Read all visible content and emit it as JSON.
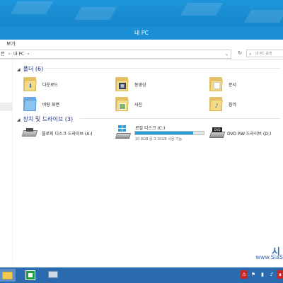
{
  "window": {
    "title": "내 PC"
  },
  "ribbon": {
    "tab_view": "보기"
  },
  "address": {
    "root_fragment": "픈",
    "sep1": "›",
    "location": "내 PC",
    "sep2": "›",
    "dropdown": "⌄",
    "refresh": "↻",
    "search_placeholder": "내 PC 검색"
  },
  "folders_section": {
    "title": "폴더 (6)",
    "chevron": "◢"
  },
  "folders": [
    {
      "label": "다운로드",
      "icon": "downloads-folder-icon"
    },
    {
      "label": "동영상",
      "icon": "videos-folder-icon"
    },
    {
      "label": "문서",
      "icon": "documents-folder-icon"
    },
    {
      "label": "바탕 화면",
      "icon": "desktop-folder-icon"
    },
    {
      "label": "사진",
      "icon": "pictures-folder-icon"
    },
    {
      "label": "음악",
      "icon": "music-folder-icon"
    }
  ],
  "devices_section": {
    "title": "장치 및 드라이브 (3)",
    "chevron": "◢"
  },
  "devices": [
    {
      "label": "플로피 디스크 드라이브 (A:)",
      "icon": "floppy-drive-icon"
    },
    {
      "label": "로컬 디스크 (C:)",
      "icon": "local-disk-icon",
      "free_text": "20.6GB 중 3.10GB 사용 가능",
      "used_fraction": 0.85
    },
    {
      "label": "DVD RW 드라이브 (D:)",
      "icon": "dvd-drive-icon"
    }
  ],
  "watermark": {
    "line1": "시",
    "line2": "www.SiaS"
  },
  "colors": {
    "titlebar": "#1b8fd6",
    "accent": "#26a0da",
    "section_header": "#1e3287",
    "taskbar": "#2a6bb0"
  }
}
